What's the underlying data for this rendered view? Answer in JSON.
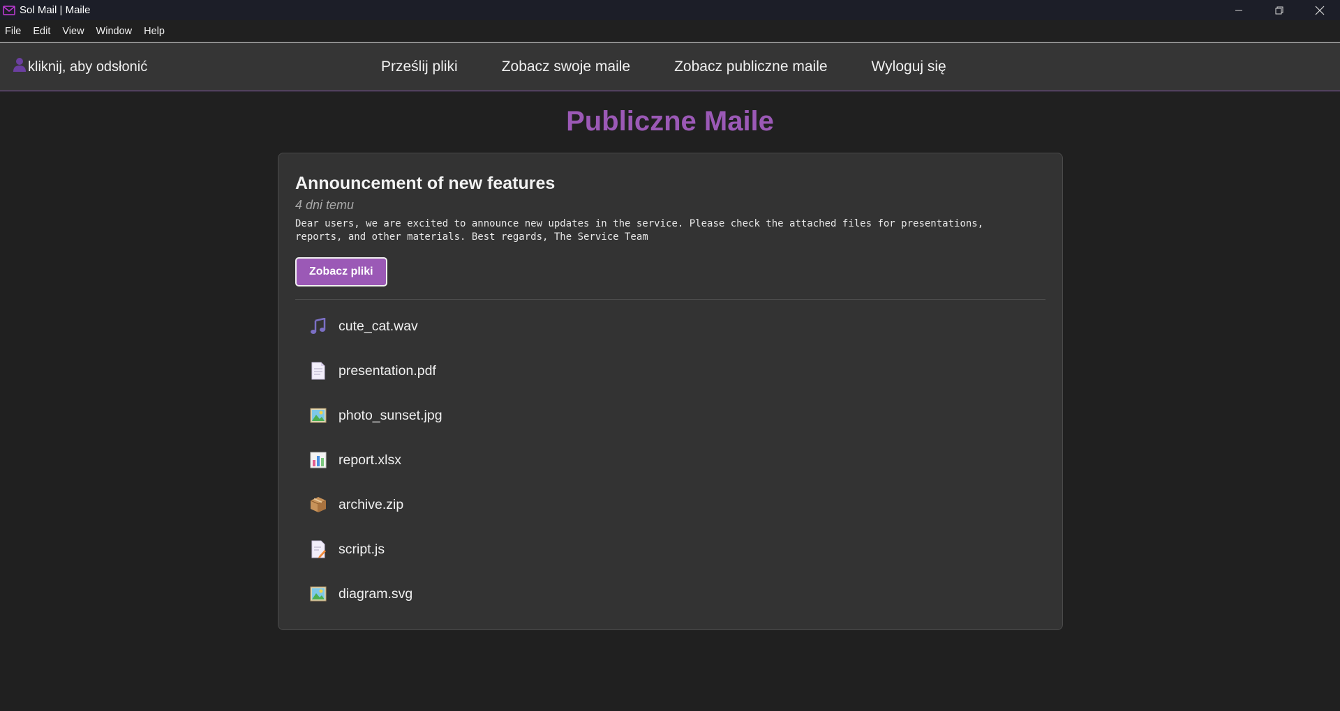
{
  "window": {
    "title": "Sol Mail | Maile",
    "app_icon": "mail-icon",
    "controls": [
      "minimize-icon",
      "restore-icon",
      "close-icon"
    ]
  },
  "menu": {
    "items": [
      "File",
      "Edit",
      "View",
      "Window",
      "Help"
    ]
  },
  "nav": {
    "user_label": "kliknij, aby odsłonić",
    "user_icon": "user-icon",
    "links": [
      "Prześlij pliki",
      "Zobacz swoje maile",
      "Zobacz publiczne maile",
      "Wyloguj się"
    ]
  },
  "main": {
    "title": "Publiczne Maile"
  },
  "mail": {
    "subject": "Announcement of new features",
    "date": "4 dni temu",
    "body": "Dear users, we are excited to announce new updates in the service. Please check the attached files for presentations, reports, and other materials. Best regards, The Service Team",
    "files_button": "Zobacz pliki",
    "files": [
      {
        "name": "cute_cat.wav",
        "icon": "music-icon"
      },
      {
        "name": "presentation.pdf",
        "icon": "document-icon"
      },
      {
        "name": "photo_sunset.jpg",
        "icon": "image-icon"
      },
      {
        "name": "report.xlsx",
        "icon": "chart-icon"
      },
      {
        "name": "archive.zip",
        "icon": "package-icon"
      },
      {
        "name": "script.js",
        "icon": "script-icon"
      },
      {
        "name": "diagram.svg",
        "icon": "image-icon"
      }
    ]
  },
  "colors": {
    "accent": "#9b59b6",
    "background": "#202020",
    "navbar": "#353535",
    "card": "#333333"
  }
}
